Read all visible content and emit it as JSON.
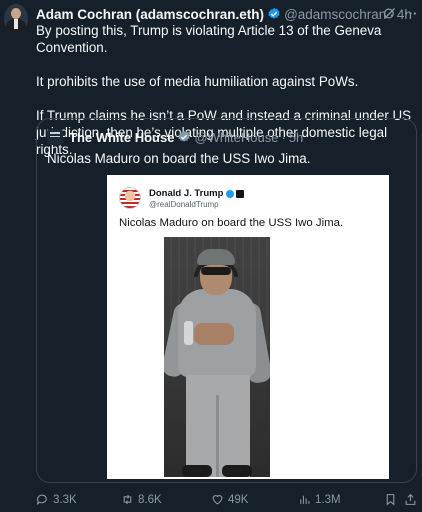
{
  "tweet": {
    "author_name": "Adam Cochran (adamscochran.eth)",
    "author_handle": "@adamscochran",
    "separator": "·",
    "time": "4h",
    "paragraphs": [
      "By posting this, Trump is violating Article 13 of the Geneva Convention.",
      "It prohibits the use of media humiliation against PoWs.",
      "If Trump claims he isn’t a PoW and instead a criminal under US jurisdiction, then he’s violating multiple other domestic legal rights."
    ],
    "icons": [
      "grok-icon",
      "more-icon"
    ]
  },
  "quote": {
    "author_name": "The White House",
    "author_handle": "@WhiteHouse",
    "separator": "·",
    "time": "5h",
    "text": "Nicolas Maduro on board the USS Iwo Jima.",
    "embedded_post": {
      "author_name": "Donald J. Trump",
      "author_handle": "@realDonaldTrump",
      "text": "Nicolas Maduro on board the USS Iwo Jima."
    }
  },
  "actions": {
    "replies": "3.3K",
    "reposts": "8.6K",
    "likes": "49K",
    "views": "1.3M"
  },
  "colors": {
    "background": "#15202b",
    "text": "#f7f9f9",
    "muted": "#8b98a5",
    "verified": "#1d9bf0",
    "border": "#38444d"
  }
}
